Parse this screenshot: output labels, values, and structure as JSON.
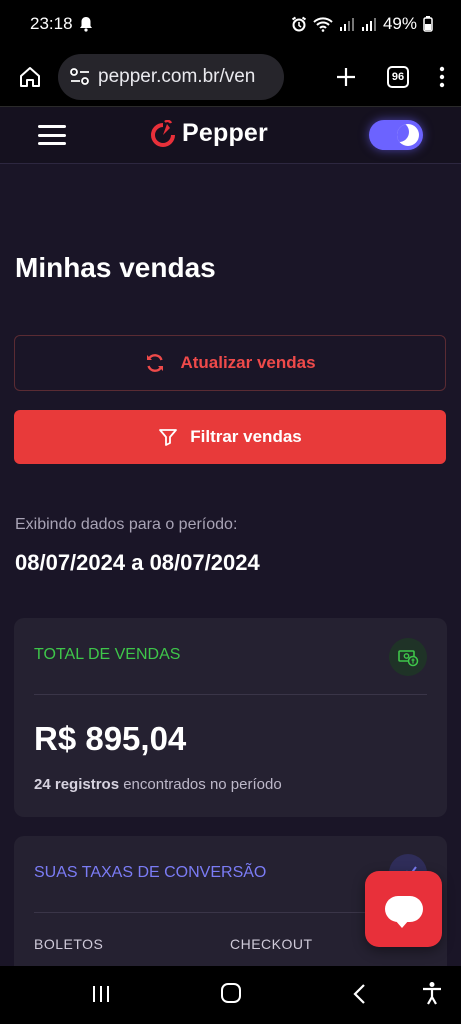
{
  "status_bar": {
    "time": "23:18",
    "battery": "49%"
  },
  "browser": {
    "url": "pepper.com.br/ven",
    "tab_count": "96"
  },
  "header": {
    "brand": "Pepper"
  },
  "page": {
    "title": "Minhas vendas",
    "update_button": "Atualizar vendas",
    "filter_button": "Filtrar vendas",
    "period_label": "Exibindo dados para o período:",
    "period_value": "08/07/2024 a 08/07/2024"
  },
  "sales_card": {
    "heading": "TOTAL DE VENDAS",
    "amount": "R$ 895,04",
    "records_count": "24 registros",
    "records_suffix": " encontrados no período"
  },
  "conversion_card": {
    "heading": "SUAS TAXAS DE CONVERSÃO",
    "columns": [
      "BOLETOS",
      "CHECKOUT"
    ]
  },
  "colors": {
    "accent_red": "#e83a3a",
    "accent_purple": "#6c63ff",
    "success_green": "#3ec64a",
    "background": "#1a1527"
  }
}
